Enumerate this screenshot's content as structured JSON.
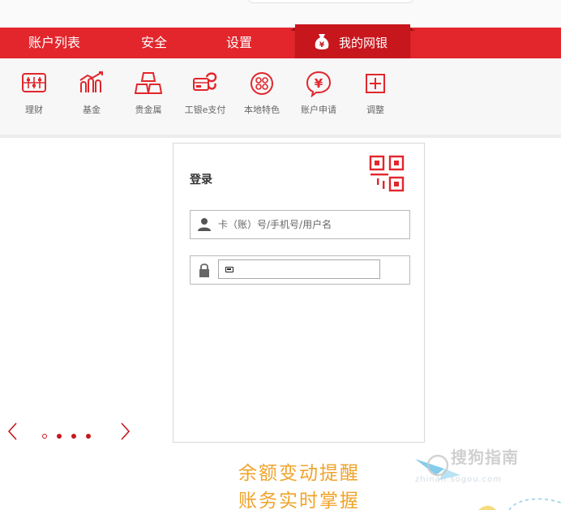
{
  "nav": {
    "items": [
      "账户列表",
      "安全",
      "设置"
    ],
    "active_label": "我的网银"
  },
  "tools": [
    {
      "label": "理财",
      "icon": "abacus-icon"
    },
    {
      "label": "基金",
      "icon": "fund-chart-icon"
    },
    {
      "label": "贵金属",
      "icon": "gold-bars-icon"
    },
    {
      "label": "工银e支付",
      "icon": "epay-card-icon"
    },
    {
      "label": "本地特色",
      "icon": "local-feature-icon"
    },
    {
      "label": "账户申请",
      "icon": "yuan-bubble-icon"
    },
    {
      "label": "调整",
      "icon": "plus-square-icon"
    }
  ],
  "login": {
    "title": "登录",
    "username_placeholder": "卡（账）号/手机号/用户名"
  },
  "promo": {
    "line1": "余额变动提醒",
    "line2": "账务实时掌握"
  },
  "watermark": {
    "brand": "搜狗指南",
    "url": "zhinan.sogou.com"
  },
  "colors": {
    "brand_red": "#e2262c",
    "active_red": "#c8161d",
    "icon_red": "#e2262c",
    "promo_orange": "#f0a32a"
  },
  "carousel": {
    "dot_count": 4,
    "current_dot": 1
  }
}
